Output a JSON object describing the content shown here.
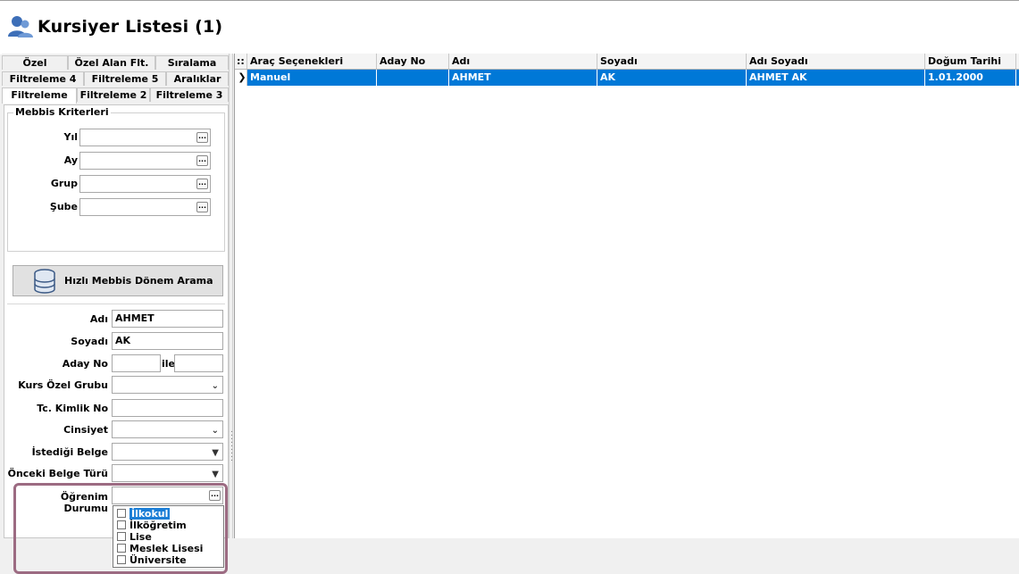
{
  "window": {
    "title": "Kursiyer Listesi (1)"
  },
  "tabs": {
    "row1": [
      "Özel",
      "Özel Alan Flt.",
      "Sıralama"
    ],
    "row2": [
      "Filtreleme 4",
      "Filtreleme 5",
      "Aralıklar"
    ],
    "row3": [
      "Filtreleme",
      "Filtreleme 2",
      "Filtreleme 3"
    ],
    "active": "Filtreleme"
  },
  "mebbis": {
    "legend": "Mebbis Kriterleri",
    "fields": [
      {
        "label": "Yıl",
        "value": ""
      },
      {
        "label": "Ay",
        "value": ""
      },
      {
        "label": "Grup",
        "value": ""
      },
      {
        "label": "Şube",
        "value": ""
      }
    ],
    "button_label": "Hızlı Mebbis Dönem Arama"
  },
  "filters": {
    "adi": {
      "label": "Adı",
      "value": "AHMET"
    },
    "soyadi": {
      "label": "Soyadı",
      "value": "AK"
    },
    "aday_no": {
      "label": "Aday No",
      "value_from": "",
      "connector": "ile",
      "value_to": ""
    },
    "kurs_ozel_grubu": {
      "label": "Kurs Özel Grubu",
      "value": ""
    },
    "tc_kimlik_no": {
      "label": "Tc. Kimlik No",
      "value": ""
    },
    "cinsiyet": {
      "label": "Cinsiyet",
      "value": ""
    },
    "istedigi_belge": {
      "label": "İstediği Belge",
      "value": ""
    },
    "onceki_belge_turu": {
      "label": "Önceki Belge Türü",
      "value": ""
    },
    "ogrenim_durumu": {
      "label": "Öğrenim Durumu",
      "value": "",
      "options": [
        "İlkokul",
        "İlköğretim",
        "Lise",
        "Meslek Lisesi",
        "Üniversite"
      ],
      "highlighted": "İlkokul"
    }
  },
  "grid": {
    "columns": [
      "Araç Seçenekleri",
      "Aday No",
      "Adı",
      "Soyadı",
      "Adı Soyadı",
      "Doğum Tarihi"
    ],
    "rows": [
      [
        "Manuel",
        "",
        "AHMET",
        "AK",
        "AHMET AK",
        "1.01.2000"
      ]
    ]
  },
  "colors": {
    "selection": "#0078d7",
    "highlight_border": "#9c6b82"
  }
}
